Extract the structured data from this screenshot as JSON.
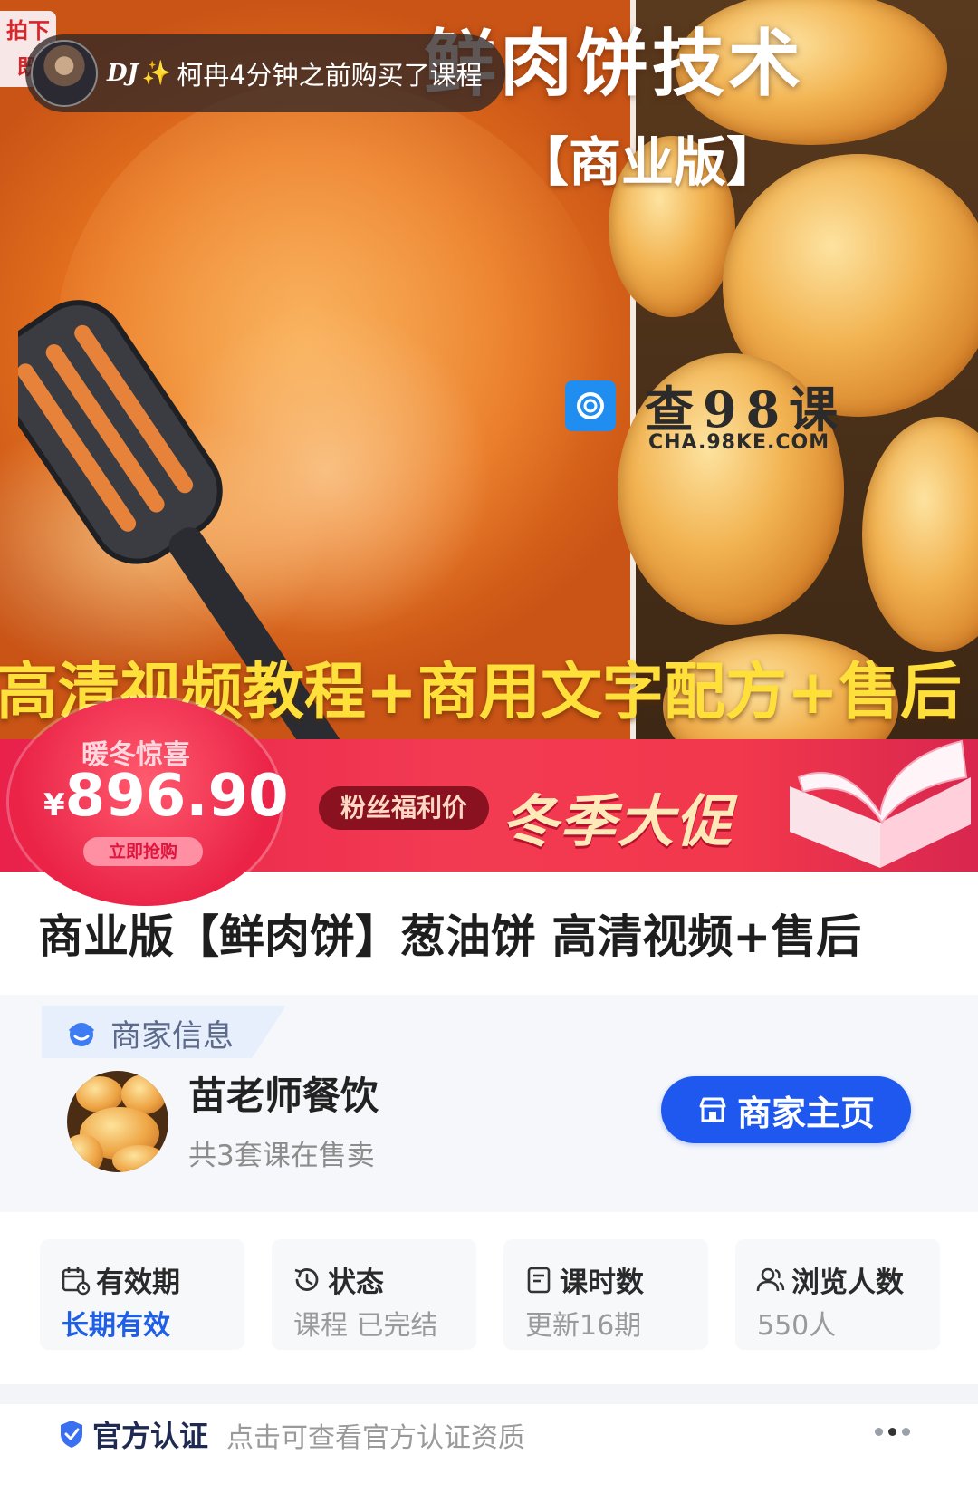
{
  "hero": {
    "title": "鲜肉饼技术",
    "subtitle": "【商业版】",
    "tagline": "高清视频教程+商用文字配方+售后",
    "corner_tag": "拍下\n既"
  },
  "toast": {
    "username": "DJ",
    "message": "柯冉4分钟之前购买了课程"
  },
  "watermark": {
    "name": "查98课",
    "url": "CHA.98KE.COM"
  },
  "promo": {
    "badge": "暖冬惊喜",
    "currency": "¥",
    "price": "896.90",
    "buy_label": "立即抢购",
    "pill_label": "粉丝福利价",
    "headline": "冬季大促"
  },
  "course": {
    "title": "商业版【鲜肉饼】葱油饼 高清视频+售后"
  },
  "merchant": {
    "section_label": "商家信息",
    "name": "苗老师餐饮",
    "course_count": "共3套课在售卖",
    "home_button": "商家主页"
  },
  "stats": [
    {
      "label": "有效期",
      "value": "长期有效",
      "icon": "calendar-icon"
    },
    {
      "label": "状态",
      "value": "课程 已完结",
      "icon": "clock-icon"
    },
    {
      "label": "课时数",
      "value": "更新16期",
      "icon": "document-icon"
    },
    {
      "label": "浏览人数",
      "value": "550人",
      "icon": "users-icon"
    }
  ],
  "certification": {
    "title": "官方认证",
    "description": "点击可查看官方认证资质"
  },
  "colors": {
    "primary_blue": "#1e58ef",
    "promo_red": "#f2384c",
    "tagline_yellow": "#ffe03a"
  }
}
